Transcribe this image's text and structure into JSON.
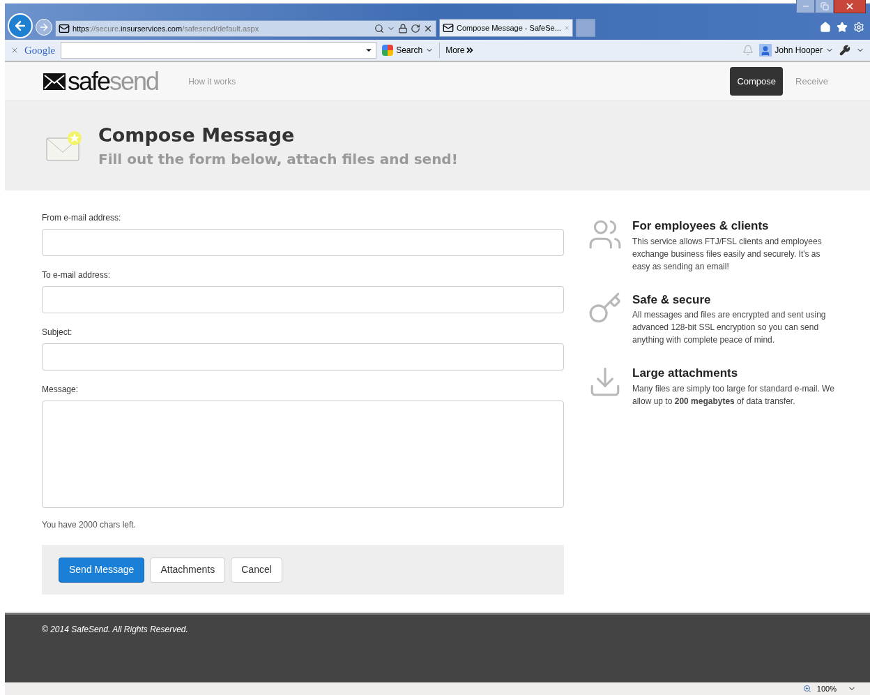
{
  "browser": {
    "url_parts": [
      {
        "text": "https",
        "dim": false
      },
      {
        "text": "://secure.",
        "dim": true
      },
      {
        "text": "insurservices.com",
        "dim": false
      },
      {
        "text": "/safesend/default.aspx",
        "dim": true
      }
    ],
    "tabs": [
      {
        "label": "Compose Message - SafeSe...",
        "selected": true
      }
    ],
    "toolbar": {
      "google": "Google",
      "search": "Search",
      "more": "More",
      "user": "John Hooper"
    }
  },
  "site": {
    "logo": {
      "dark": "safe",
      "light": "send"
    },
    "nav_left": [
      {
        "label": "How it works",
        "selected": false
      }
    ],
    "nav_right": [
      {
        "label": "Compose",
        "selected": true
      },
      {
        "label": "Receive",
        "selected": false
      }
    ]
  },
  "banner": {
    "title": "Compose Message",
    "subtitle": "Fill out the form below, attach files and send!"
  },
  "form": {
    "fields": [
      {
        "label": "From e-mail address:",
        "kind": "line"
      },
      {
        "label": "To e-mail address:",
        "kind": "line"
      },
      {
        "label": "Subject:",
        "kind": "line"
      },
      {
        "label": "Message:",
        "kind": "area"
      }
    ],
    "counter": "You have 2000 chars left.",
    "buttons": [
      {
        "label": "Send Message",
        "kind": "primary"
      },
      {
        "label": "Attachments",
        "kind": "default"
      },
      {
        "label": "Cancel",
        "kind": "default"
      }
    ]
  },
  "features": [
    {
      "kind": "people",
      "title": "For employees & clients",
      "text": "This service allows FTJ/FSL clients and employees exchange business files easily and securely. It's as easy as sending an email!"
    },
    {
      "kind": "keys",
      "title": "Safe & secure",
      "text": "All messages and files are encrypted and sent using advanced 128-bit SSL encryption so you can send anything with complete peace of mind."
    },
    {
      "kind": "download",
      "title": "Large attachments",
      "text": "Many files are simply too large for standard e-mail. We allow up to **200 megabytes** of data transfer."
    }
  ],
  "footer": {
    "text": "© 2014 SafeSend. All Rights Reserved."
  },
  "status_bar": {
    "zoom": "100%"
  }
}
